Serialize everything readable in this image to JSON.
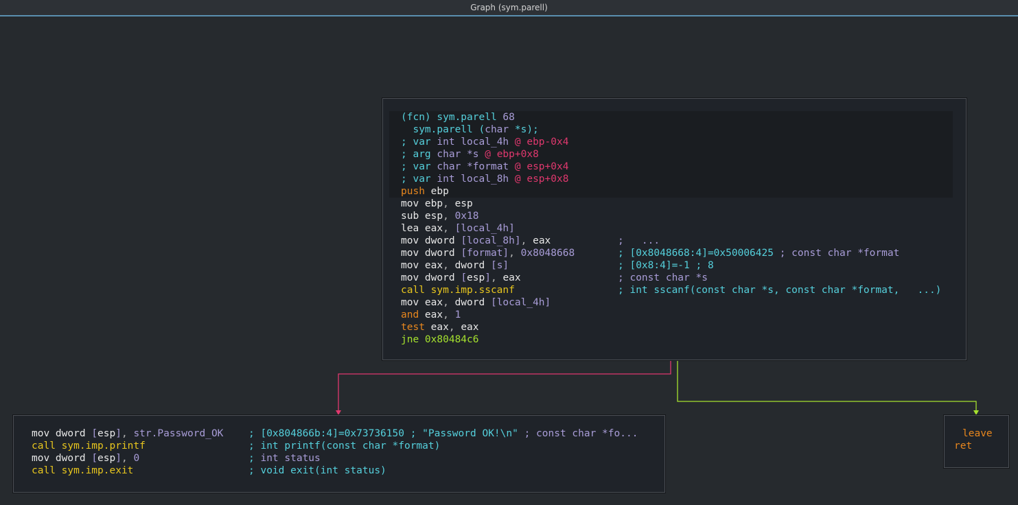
{
  "window": {
    "title": "Graph (sym.parell)"
  },
  "colors": {
    "background": "#262a2e",
    "node_background": "#1f2329",
    "edge_true": "#e0386e",
    "edge_false": "#a6e22e"
  },
  "blocks": {
    "main": {
      "header": [
        "(fcn) sym.parell 68",
        "  sym.parell (char *s);",
        "; var int local_4h @ ebp-0x4",
        "; arg char *s @ ebp+0x8",
        "; var char *format @ esp+0x4",
        "; var int local_8h @ esp+0x8"
      ],
      "lines": [
        {
          "asm": "push ebp",
          "comment": ""
        },
        {
          "asm": "mov ebp, esp",
          "comment": ""
        },
        {
          "asm": "sub esp, 0x18",
          "comment": ""
        },
        {
          "asm": "lea eax, [local_4h]",
          "comment": ""
        },
        {
          "asm": "mov dword [local_8h], eax",
          "comment": ";   ..."
        },
        {
          "asm": "mov dword [format], 0x8048668",
          "comment": "; [0x8048668:4]=0x50006425 ; const char *format"
        },
        {
          "asm": "mov eax, dword [s]",
          "comment": "; [0x8:4]=-1 ; 8"
        },
        {
          "asm": "mov dword [esp], eax",
          "comment": "; const char *s"
        },
        {
          "asm": "call sym.imp.sscanf",
          "comment": "; int sscanf(const char *s, const char *format,   ...)"
        },
        {
          "asm": "mov eax, dword [local_4h]",
          "comment": ""
        },
        {
          "asm": "and eax, 1",
          "comment": ""
        },
        {
          "asm": "test eax, eax",
          "comment": ""
        },
        {
          "asm": "jne 0x80484c6",
          "comment": ""
        }
      ]
    },
    "fail": {
      "lines": [
        {
          "asm": "mov dword [esp], str.Password_OK",
          "comment": "; [0x804866b:4]=0x73736150 ; \"Password OK!\\n\" ; const char *fo..."
        },
        {
          "asm": "call sym.imp.printf",
          "comment": "; int printf(const char *format)"
        },
        {
          "asm": "mov dword [esp], 0",
          "comment": "; int status"
        },
        {
          "asm": "call sym.imp.exit",
          "comment": "; void exit(int status)"
        }
      ]
    },
    "exit": {
      "lines": [
        {
          "asm": "leave"
        },
        {
          "asm": "ret"
        }
      ]
    }
  }
}
